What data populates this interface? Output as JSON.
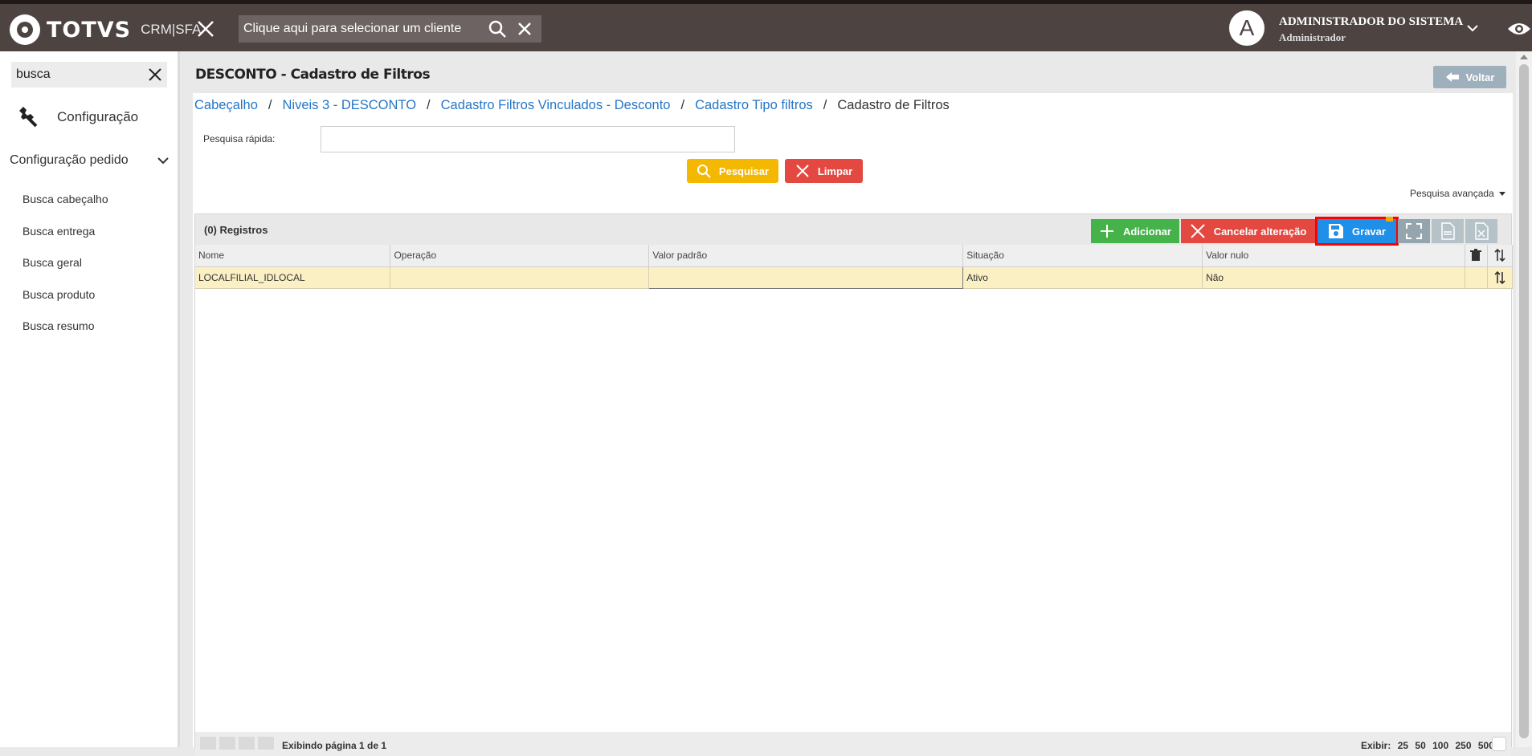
{
  "header": {
    "logo_text": "TOTVS",
    "logo_sub": "CRM|SFA",
    "client_search_placeholder": "Clique aqui para selecionar um cliente",
    "avatar_letter": "A",
    "user_name": "ADMINISTRADOR DO SISTEMA",
    "user_role": "Administrador",
    "colors": {
      "bar": "#4d4442",
      "stripe": "#1f1a19"
    }
  },
  "sidebar": {
    "search_value": "busca",
    "config_label": "Configuração",
    "group_label": "Configuração pedido",
    "items": [
      {
        "label": "Busca cabeçalho"
      },
      {
        "label": "Busca entrega"
      },
      {
        "label": "Busca geral"
      },
      {
        "label": "Busca produto"
      },
      {
        "label": "Busca resumo"
      }
    ]
  },
  "page": {
    "title": "DESCONTO - Cadastro de Filtros",
    "back_label": "Voltar",
    "breadcrumbs": [
      "Cabeçalho",
      "Niveis 3 - DESCONTO",
      "Cadastro Filtros Vinculados - Desconto",
      "Cadastro Tipo filtros"
    ],
    "breadcrumb_current": "Cadastro de Filtros",
    "quick_search_label": "Pesquisa rápida:",
    "quick_search_value": "",
    "search_button": "Pesquisar",
    "clear_button": "Limpar",
    "advanced_search": "Pesquisa avançada"
  },
  "grid": {
    "records_label": "(0) Registros",
    "add_button": "Adicionar",
    "cancel_button": "Cancelar alteração",
    "save_button": "Gravar",
    "columns": [
      "Nome",
      "Operação",
      "Valor padrão",
      "Situação",
      "Valor nulo"
    ],
    "rows": [
      {
        "nome": "LOCALFILIAL_IDLOCAL",
        "operacao": "",
        "valor_padrao": "",
        "situacao": "Ativo",
        "valor_nulo": "Não"
      }
    ],
    "footer": {
      "page_info": "Exibindo página 1 de 1",
      "show_label": "Exibir:",
      "page_sizes": [
        "25",
        "50",
        "100",
        "250",
        "500"
      ]
    },
    "colors": {
      "add": "#46b34a",
      "cancel": "#e34940",
      "save": "#1f8fe8",
      "highlight": "#ff0000",
      "row": "#fbf0c4"
    }
  }
}
